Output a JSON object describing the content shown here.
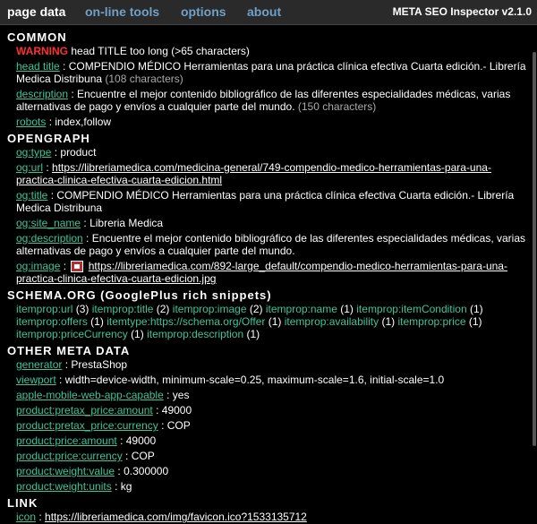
{
  "tabs": [
    {
      "label": "page data"
    },
    {
      "label": "on-line tools"
    },
    {
      "label": "options"
    },
    {
      "label": "about"
    }
  ],
  "app_title": "META SEO Inspector v2.1.0",
  "common": {
    "title": "COMMON",
    "warning_label": "WARNING",
    "warning_text": "head TITLE too long (>65 characters)",
    "head_title": {
      "key": "head title",
      "value": "COMPENDIO MÉDICO Herramientas para una práctica clínica efectiva Cuarta edición.- Librería Medica Distribuna",
      "count": "(108 characters)"
    },
    "description": {
      "key": "description",
      "value": "Encuentre el mejor contenido bibliográfico de las diferentes especialidades médicas, varias alternativas de pago y envíos a cualquier parte del mundo.",
      "count": "(150 characters)"
    },
    "robots": {
      "key": "robots",
      "value": "index,follow"
    }
  },
  "opengraph": {
    "title": "OPENGRAPH",
    "items": [
      {
        "key": "og:type",
        "value": "product"
      },
      {
        "key": "og:url",
        "value": "https://libreriamedica.com/medicina-general/749-compendio-medico-herramientas-para-una-practica-clinica-efectiva-cuarta-edicion.html"
      },
      {
        "key": "og:title",
        "value": "COMPENDIO MÉDICO Herramientas para una práctica clínica efectiva Cuarta edición.- Librería Medica Distribuna"
      },
      {
        "key": "og:site_name",
        "value": "Libreria Medica"
      },
      {
        "key": "og:description",
        "value": "Encuentre el mejor contenido bibliográfico de las diferentes especialidades médicas, varias alternativas de pago y envíos a cualquier parte del mundo."
      },
      {
        "key": "og:image",
        "value": "https://libreriamedica.com/892-large_default/compendio-medico-herramientas-para-una-practica-clinica-efectiva-cuarta-edicion.jpg"
      }
    ]
  },
  "schema": {
    "title": "SCHEMA.ORG (GooglePlus rich snippets)",
    "items": [
      {
        "key": "itemprop:url",
        "count": "(3)"
      },
      {
        "key": "itemprop:title",
        "count": "(2)"
      },
      {
        "key": "itemprop:image",
        "count": "(2)"
      },
      {
        "key": "itemprop:name",
        "count": "(1)"
      },
      {
        "key": "itemprop:itemCondition",
        "count": "(1)"
      },
      {
        "key": "itemprop:offers",
        "count": "(1)"
      },
      {
        "key": "itemtype:https://schema.org/Offer",
        "count": "(1)"
      },
      {
        "key": "itemprop:availability",
        "count": "(1)"
      },
      {
        "key": "itemprop:price",
        "count": "(1)"
      },
      {
        "key": "itemprop:priceCurrency",
        "count": "(1)"
      },
      {
        "key": "itemprop:description",
        "count": "(1)"
      }
    ]
  },
  "other": {
    "title": "OTHER META DATA",
    "items": [
      {
        "key": "generator",
        "value": "PrestaShop"
      },
      {
        "key": "viewport",
        "value": "width=device-width, minimum-scale=0.25, maximum-scale=1.6, initial-scale=1.0"
      },
      {
        "key": "apple-mobile-web-app-capable",
        "value": "yes"
      },
      {
        "key": "product:pretax_price:amount",
        "value": "49000"
      },
      {
        "key": "product:pretax_price:currency",
        "value": "COP"
      },
      {
        "key": "product:price:amount",
        "value": "49000"
      },
      {
        "key": "product:price:currency",
        "value": "COP"
      },
      {
        "key": "product:weight:value",
        "value": "0.300000"
      },
      {
        "key": "product:weight:units",
        "value": "kg"
      }
    ]
  },
  "link": {
    "title": "LINK",
    "items": [
      {
        "key": "icon",
        "value": "https://libreriamedica.com/img/favicon.ico?1533135712"
      }
    ]
  },
  "colors": {
    "key": "#3dc49a",
    "warning": "#ff3030",
    "tab": "#6fa0c8"
  }
}
